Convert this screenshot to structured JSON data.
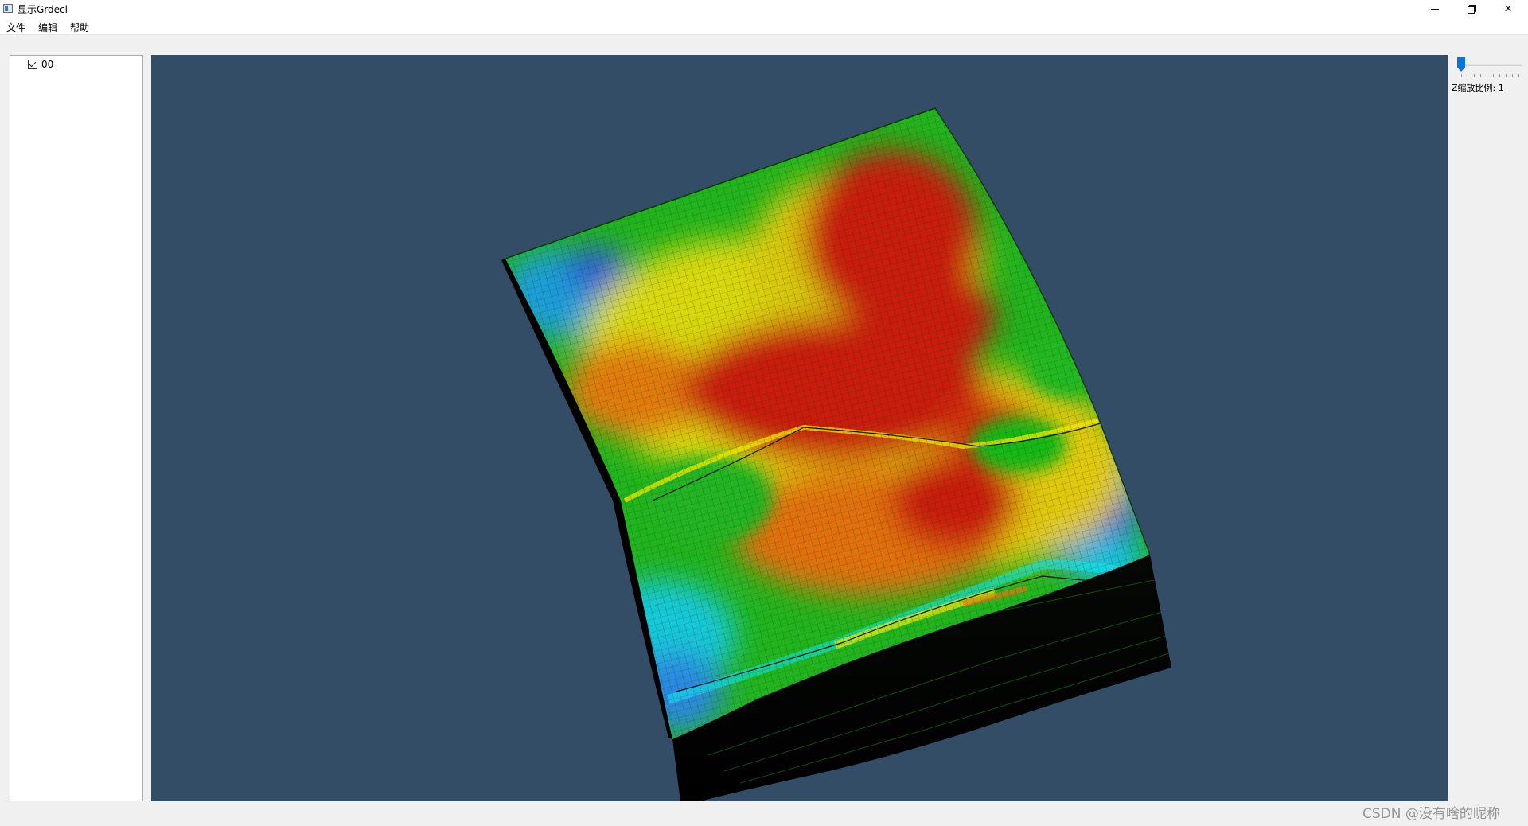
{
  "window": {
    "title": "显示Grdecl",
    "controls": {
      "minimize_icon": "minimize-icon",
      "restore_icon": "restore-icon",
      "close_glyph": "✕"
    }
  },
  "menu": {
    "items": [
      {
        "label": "文件"
      },
      {
        "label": "编辑"
      },
      {
        "label": "帮助"
      }
    ]
  },
  "tree": {
    "items": [
      {
        "label": "00",
        "checked": true
      }
    ]
  },
  "viewport": {
    "background": "#344d66",
    "model_colormap": [
      "#0033c8",
      "#00c8ff",
      "#00f0ff",
      "#10c010",
      "#e8e800",
      "#ff7000",
      "#d01000"
    ]
  },
  "controls": {
    "z_scale_label": "Z缩放比例: 1",
    "z_scale_value": 1
  },
  "watermark": "CSDN @没有啥的昵称"
}
